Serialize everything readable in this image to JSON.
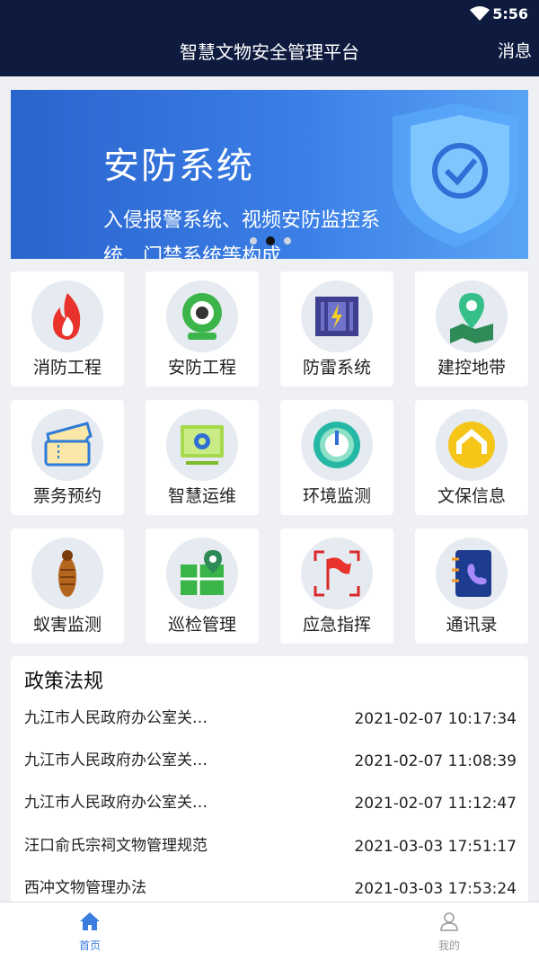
{
  "status_bar": {
    "time": "5:56"
  },
  "header": {
    "title": "智慧文物安全管理平台",
    "message_label": "消息"
  },
  "banner": {
    "title": "安防系统",
    "subtitle": "入侵报警系统、视频安防监控系统、门禁系统等构成",
    "active_dot": 1,
    "dot_count": 3
  },
  "features": [
    {
      "label": "消防工程",
      "icon": "fire-icon"
    },
    {
      "label": "安防工程",
      "icon": "camera-icon"
    },
    {
      "label": "防雷系统",
      "icon": "lightning-icon"
    },
    {
      "label": "建控地带",
      "icon": "map-pin-icon"
    },
    {
      "label": "票务预约",
      "icon": "ticket-icon"
    },
    {
      "label": "智慧运维",
      "icon": "monitor-gear-icon"
    },
    {
      "label": "环境监测",
      "icon": "gauge-icon"
    },
    {
      "label": "文保信息",
      "icon": "heritage-info-icon"
    },
    {
      "label": "蚁害监测",
      "icon": "termite-icon"
    },
    {
      "label": "巡检管理",
      "icon": "patrol-map-icon"
    },
    {
      "label": "应急指挥",
      "icon": "flag-icon"
    },
    {
      "label": "通讯录",
      "icon": "phone-book-icon"
    }
  ],
  "policy": {
    "title": "政策法规",
    "items": [
      {
        "text": "九江市人民政府办公室关…",
        "date": "2021-02-07 10:17:34"
      },
      {
        "text": "九江市人民政府办公室关…",
        "date": "2021-02-07 11:08:39"
      },
      {
        "text": "九江市人民政府办公室关…",
        "date": "2021-02-07 11:12:47"
      },
      {
        "text": "汪口俞氏宗祠文物管理规范",
        "date": "2021-03-03 17:51:17"
      },
      {
        "text": "西冲文物管理办法",
        "date": "2021-03-03 17:53:24"
      }
    ]
  },
  "tabbar": {
    "home_label": "首页",
    "mine_label": "我的",
    "active_color": "#3b7ce0",
    "inactive_color": "#999999"
  }
}
